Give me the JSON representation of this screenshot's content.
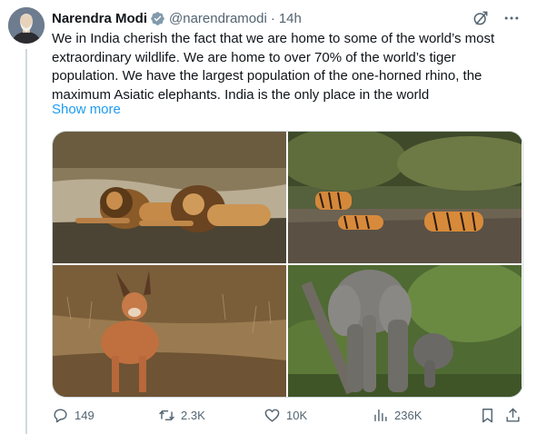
{
  "post": {
    "author_name": "Narendra Modi",
    "handle": "@narendramodi",
    "separator": "·",
    "time": "14h",
    "text": "We in India cherish the fact that we are home to some of the world’s most extraordinary wildlife. We are home to over 70% of the world’s tiger population. We have the largest population of the one-horned rhino, the maximum Asiatic elephants. India is the only place in the world",
    "show_more": "Show more",
    "verified_color": "#829aab",
    "link_color": "#1d9bf0"
  },
  "media": [
    {
      "icon": "lions-photo"
    },
    {
      "icon": "tigers-photo"
    },
    {
      "icon": "caracal-photo"
    },
    {
      "icon": "elephants-photo"
    }
  ],
  "actions": {
    "replies": "149",
    "reposts": "2.3K",
    "likes": "10K",
    "views": "236K"
  },
  "icons": {
    "grok": "grok-icon",
    "more": "more-icon",
    "reply": "reply-icon",
    "repost": "repost-icon",
    "like": "like-icon",
    "views": "views-icon",
    "bookmark": "bookmark-icon",
    "share": "share-icon"
  }
}
